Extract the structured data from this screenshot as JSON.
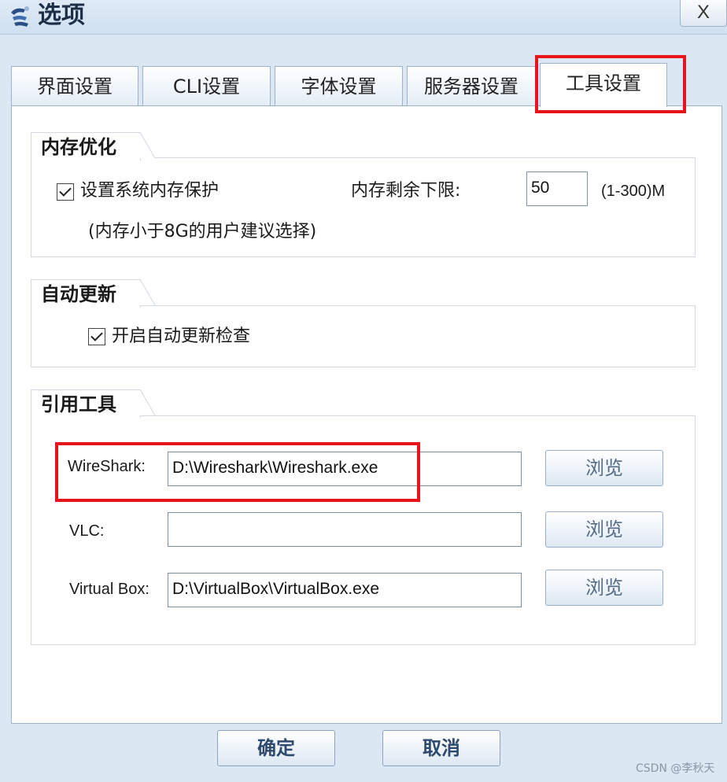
{
  "window": {
    "title": "选项",
    "close_label": "X",
    "icon": "app-logo-icon"
  },
  "tabs": [
    {
      "label": "界面设置",
      "active": false
    },
    {
      "label": "CLI设置",
      "active": false
    },
    {
      "label": "字体设置",
      "active": false
    },
    {
      "label": "服务器设置",
      "active": false
    },
    {
      "label": "工具设置",
      "active": true
    }
  ],
  "memory": {
    "group_title": "内存优化",
    "protect_label": "设置系统内存保护",
    "protect_checked": true,
    "hint": "(内存小于8G的用户建议选择)",
    "limit_label": "内存剩余下限:",
    "limit_value": "50",
    "limit_range": "(1-300)M"
  },
  "update": {
    "group_title": "自动更新",
    "auto_check_label": "开启自动更新检查",
    "auto_check_checked": true
  },
  "tools": {
    "group_title": "引用工具",
    "items": [
      {
        "label": "WireShark:",
        "value": "D:\\Wireshark\\Wireshark.exe",
        "button": "浏览"
      },
      {
        "label": "VLC:",
        "value": "",
        "button": "浏览"
      },
      {
        "label": "Virtual Box:",
        "value": "D:\\VirtualBox\\VirtualBox.exe",
        "button": "浏览"
      }
    ]
  },
  "footer": {
    "ok_label": "确定",
    "cancel_label": "取消"
  },
  "watermark": "CSDN @李秋天",
  "colors": {
    "highlight": "#e8141c",
    "window_bg": "#dbe8f4"
  }
}
